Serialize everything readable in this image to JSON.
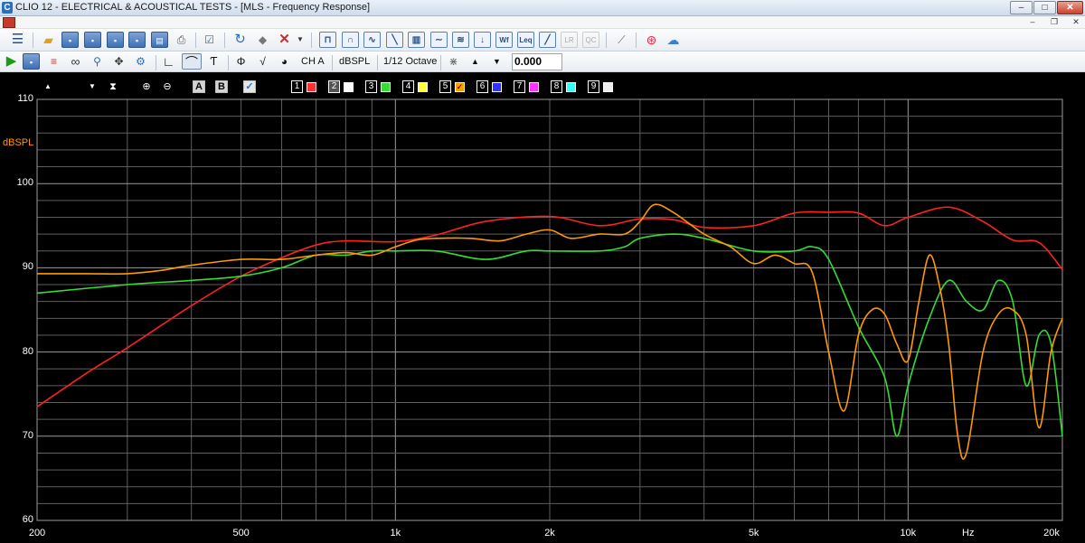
{
  "window": {
    "app_icon": "C",
    "title": "CLIO 12 - ELECTRICAL & ACOUSTICAL TESTS - [MLS - Frequency Response]",
    "controls": {
      "minimize": "‒",
      "maximize": "□",
      "close": "✕"
    },
    "mdi_controls": {
      "minimize": "‒",
      "restore": "❐",
      "close": "✕"
    }
  },
  "toolbar2": {
    "channel": "CH A",
    "unit": "dBSPL",
    "smoothing": "1/12 Octave",
    "value": "0.000"
  },
  "graph_toolbar": {
    "toggle_a": "A",
    "toggle_b": "B",
    "check": "✓",
    "traces": [
      {
        "num": "1",
        "color": "#ff3030",
        "checked": false
      },
      {
        "num": "2",
        "color": "#ffffff",
        "checked": false,
        "active": true
      },
      {
        "num": "3",
        "color": "#33dd33",
        "checked": false
      },
      {
        "num": "4",
        "color": "#ffff33",
        "checked": false
      },
      {
        "num": "5",
        "color": "#ff9900",
        "checked": true
      },
      {
        "num": "6",
        "color": "#3333ff",
        "checked": false
      },
      {
        "num": "7",
        "color": "#ff33ff",
        "checked": false
      },
      {
        "num": "8",
        "color": "#33ffff",
        "checked": false
      },
      {
        "num": "9",
        "color": "#eeeeee",
        "checked": false
      }
    ]
  },
  "chart_data": {
    "type": "line",
    "title": "",
    "xlabel": "Hz",
    "ylabel": "dBSPL",
    "x_scale": "log",
    "xlim": [
      200,
      20000
    ],
    "ylim": [
      60,
      110
    ],
    "x_ticks": [
      200,
      500,
      1000,
      2000,
      5000,
      10000,
      20000
    ],
    "x_tick_labels": [
      "200",
      "500",
      "1k",
      "2k",
      "5k",
      "10k",
      "20k"
    ],
    "y_ticks": [
      60,
      70,
      80,
      90,
      100,
      110
    ],
    "y_tick_labels": [
      "60",
      "70",
      "80",
      "90",
      "100",
      "110"
    ],
    "grid": true,
    "background": "#000000",
    "series": [
      {
        "color": "#ff2020",
        "x": [
          200,
          250,
          300,
          400,
          500,
          600,
          700,
          800,
          1000,
          1200,
          1500,
          2000,
          2500,
          3000,
          3500,
          4000,
          5000,
          6000,
          7000,
          8000,
          9000,
          10000,
          12000,
          14000,
          16000,
          18000,
          20000
        ],
        "y": [
          73.5,
          77.5,
          80.5,
          85.5,
          89,
          91.2,
          92.7,
          93.2,
          93.1,
          93.9,
          95.5,
          96.1,
          95,
          95.8,
          95.7,
          94.8,
          95,
          96.5,
          96.6,
          96.5,
          95,
          96,
          97.2,
          95.5,
          93.3,
          93,
          89.8
        ]
      },
      {
        "color": "#33dd33",
        "x": [
          200,
          300,
          400,
          500,
          600,
          700,
          800,
          900,
          1000,
          1200,
          1500,
          1800,
          2000,
          2500,
          2800,
          3000,
          3500,
          4000,
          5000,
          6000,
          6500,
          7000,
          8000,
          9000,
          9500,
          10000,
          11000,
          12000,
          13000,
          14000,
          15000,
          16000,
          17000,
          18000,
          19000,
          20000
        ],
        "y": [
          87,
          88,
          88.5,
          89,
          90,
          91.5,
          91.5,
          92,
          92,
          92,
          91,
          92,
          92,
          92,
          92.5,
          93.5,
          94,
          93.5,
          92,
          92,
          92.5,
          91,
          83,
          77,
          70,
          76,
          84,
          88.5,
          86,
          85,
          88.5,
          86,
          76,
          82,
          81,
          70
        ]
      },
      {
        "color": "#ff9900",
        "x": [
          200,
          250,
          300,
          350,
          400,
          500,
          600,
          700,
          800,
          900,
          1000,
          1100,
          1200,
          1400,
          1600,
          1800,
          2000,
          2200,
          2500,
          2800,
          3000,
          3200,
          3500,
          4000,
          4500,
          5000,
          5500,
          6000,
          6500,
          7000,
          7500,
          8000,
          8500,
          9000,
          9500,
          10000,
          10500,
          11000,
          11500,
          12000,
          12500,
          13000,
          14000,
          15000,
          16000,
          17000,
          18000,
          19000,
          20000
        ],
        "y": [
          89.3,
          89.3,
          89.3,
          89.7,
          90.3,
          91,
          91,
          91.5,
          91.8,
          91.5,
          92.5,
          93.3,
          93.5,
          93.5,
          93.2,
          94,
          94.5,
          93.5,
          94,
          94,
          95.5,
          97.5,
          96.5,
          94,
          92.5,
          90.5,
          91.5,
          90.5,
          89.5,
          80,
          73,
          82,
          85,
          84.5,
          81,
          79,
          86,
          91.5,
          88,
          81,
          70,
          68,
          80,
          84.5,
          85,
          82,
          71,
          80,
          84
        ]
      }
    ]
  }
}
